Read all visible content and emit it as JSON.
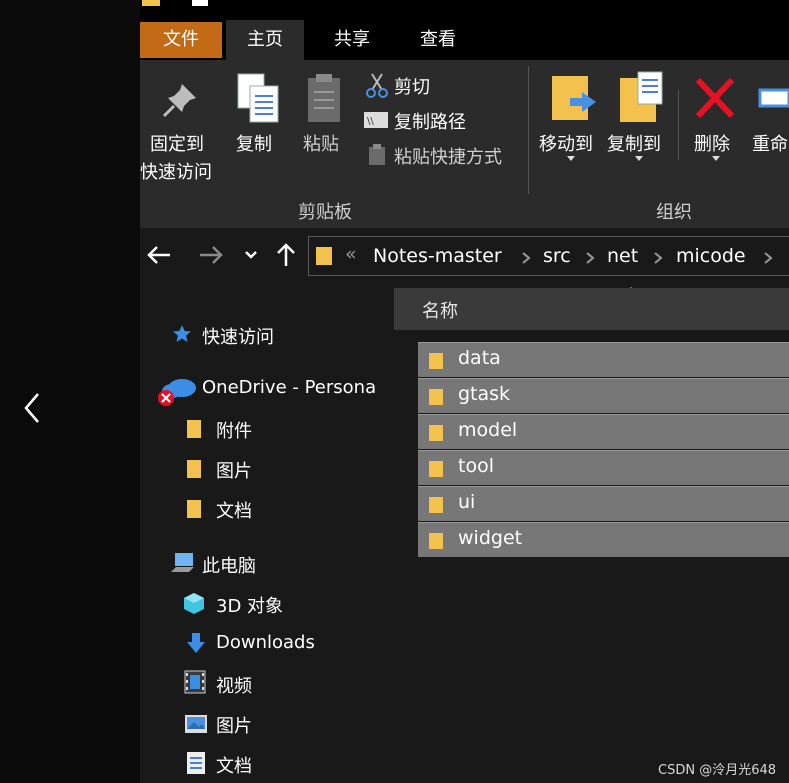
{
  "ribbon": {
    "tabs": {
      "file": "文件",
      "home": "主页",
      "share": "共享",
      "view": "查看"
    },
    "clipboard": {
      "pin_line1": "固定到",
      "pin_line2": "快速访问",
      "copy": "复制",
      "paste": "粘贴",
      "cut": "剪切",
      "copy_path": "复制路径",
      "paste_shortcut": "粘贴快捷方式",
      "group_label": "剪贴板"
    },
    "organize": {
      "move_to": "移动到",
      "copy_to": "复制到",
      "delete": "删除",
      "rename": "重命",
      "group_label": "组织"
    }
  },
  "address_bar": {
    "overflow": "«",
    "breadcrumbs": [
      "Notes-master",
      "src",
      "net",
      "micode"
    ]
  },
  "navigation": {
    "quick_access": "快速访问",
    "onedrive": "OneDrive - Persona",
    "onedrive_children": [
      "附件",
      "图片",
      "文档"
    ],
    "this_pc": "此电脑",
    "this_pc_children": [
      "3D 对象",
      "Downloads",
      "视频",
      "图片",
      "文档"
    ]
  },
  "file_list": {
    "column_name": "名称",
    "items": [
      "data",
      "gtask",
      "model",
      "tool",
      "ui",
      "widget"
    ]
  },
  "watermark": "CSDN @泠月光648",
  "colors": {
    "accent_file_tab": "#c36a16",
    "folder": "#f2c14e",
    "delete_red": "#e81123",
    "selection": "#777777"
  },
  "icons": [
    "pin-icon",
    "copy-icon",
    "paste-icon",
    "scissors-icon",
    "copy-path-icon",
    "paste-shortcut-icon",
    "move-to-icon",
    "copy-to-icon",
    "delete-icon",
    "rename-icon",
    "folder-icon",
    "star-icon",
    "cloud-icon",
    "computer-icon",
    "cube-icon",
    "download-arrow-icon",
    "video-icon",
    "picture-icon",
    "document-icon"
  ]
}
